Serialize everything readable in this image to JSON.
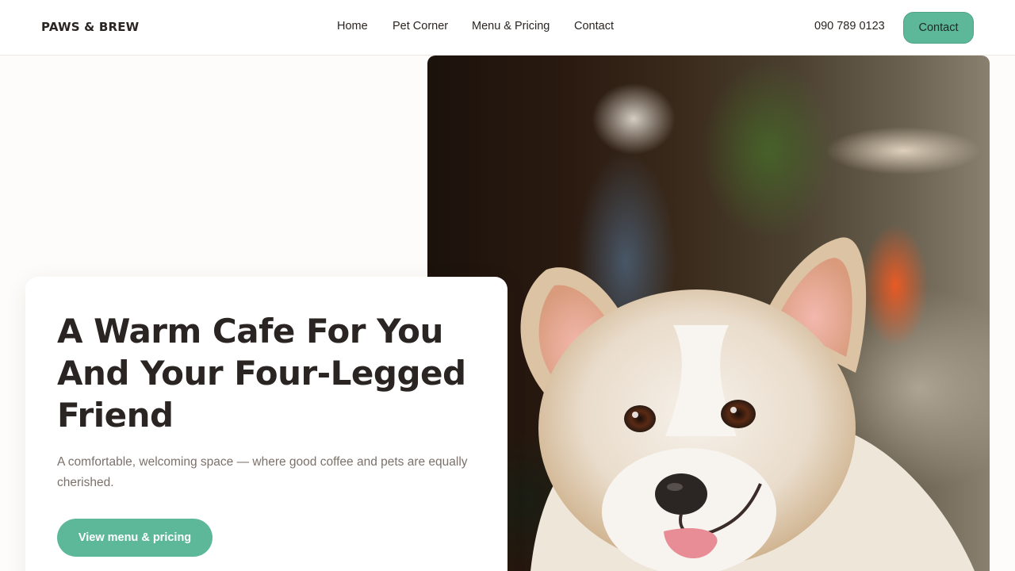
{
  "brand": {
    "name": "PAWS & BREW"
  },
  "nav": {
    "items": [
      {
        "label": "Home"
      },
      {
        "label": "Pet Corner"
      },
      {
        "label": "Menu & Pricing"
      },
      {
        "label": "Contact"
      }
    ]
  },
  "header": {
    "phone": "090 789 0123",
    "contact_button": "Contact"
  },
  "hero": {
    "title": "A Warm Cafe For You And Your Four-Legged Friend",
    "subtitle": "A comfortable, welcoming space — where good coffee and pets are equally cherished.",
    "cta_label": "View menu & pricing",
    "image": "corgi-photo"
  },
  "colors": {
    "accent": "#5db89a",
    "text": "#2a2522",
    "muted_text": "#7c716a",
    "background": "#fdfcfa"
  }
}
